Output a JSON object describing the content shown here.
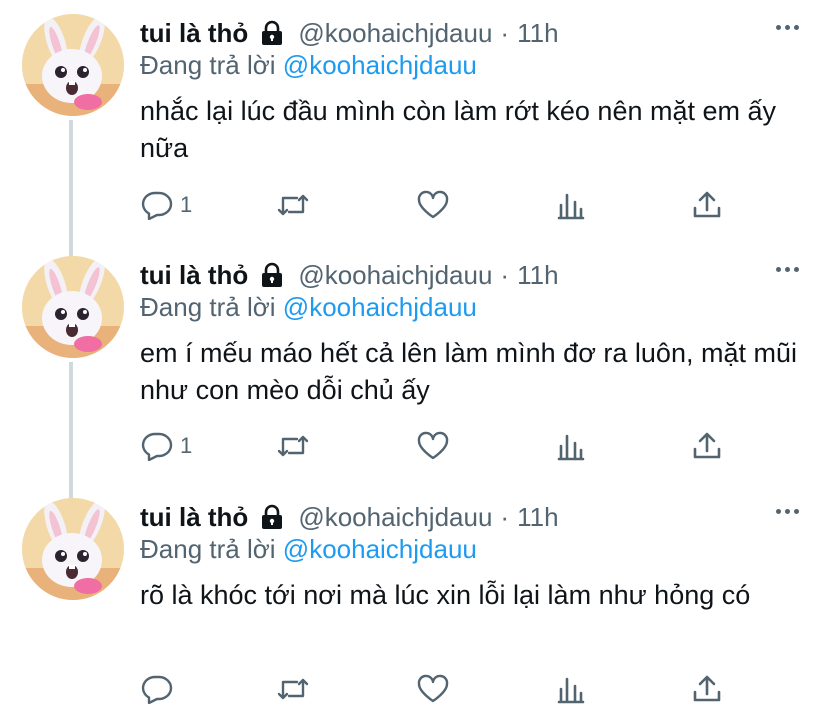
{
  "tweets": [
    {
      "author_name": "tui là thỏ",
      "handle": "@koohaichjdauu",
      "dot": "·",
      "time": "11h",
      "reply_prefix": "Đang trả lời",
      "reply_mention": "@koohaichjdauu",
      "text": "nhắc lại lúc đầu mình còn làm rớt kéo nên mặt em ấy nữa",
      "reply_count": "1",
      "retweet_count": "",
      "like_count": ""
    },
    {
      "author_name": "tui là thỏ",
      "handle": "@koohaichjdauu",
      "dot": "·",
      "time": "11h",
      "reply_prefix": "Đang trả lời",
      "reply_mention": "@koohaichjdauu",
      "text": "em í mếu máo hết cả lên làm mình đơ ra luôn, mặt mũi như con mèo dỗi chủ ấy",
      "reply_count": "1",
      "retweet_count": "",
      "like_count": ""
    },
    {
      "author_name": "tui là thỏ",
      "handle": "@koohaichjdauu",
      "dot": "·",
      "time": "11h",
      "reply_prefix": "Đang trả lời",
      "reply_mention": "@koohaichjdauu",
      "text": "rõ là khóc tới nơi mà lúc xin lỗi lại làm như hỏng có",
      "reply_count": "",
      "retweet_count": "",
      "like_count": ""
    }
  ],
  "icons": {
    "avatar": "bunny-avatar",
    "protected": "lock-icon",
    "more": "more-icon",
    "reply": "reply-icon",
    "retweet": "retweet-icon",
    "like": "heart-icon",
    "views": "analytics-icon",
    "share": "share-icon"
  },
  "colors": {
    "text": "#0f1419",
    "secondary": "#536471",
    "link": "#1d9bf0",
    "thread_line": "#cfd9de"
  }
}
